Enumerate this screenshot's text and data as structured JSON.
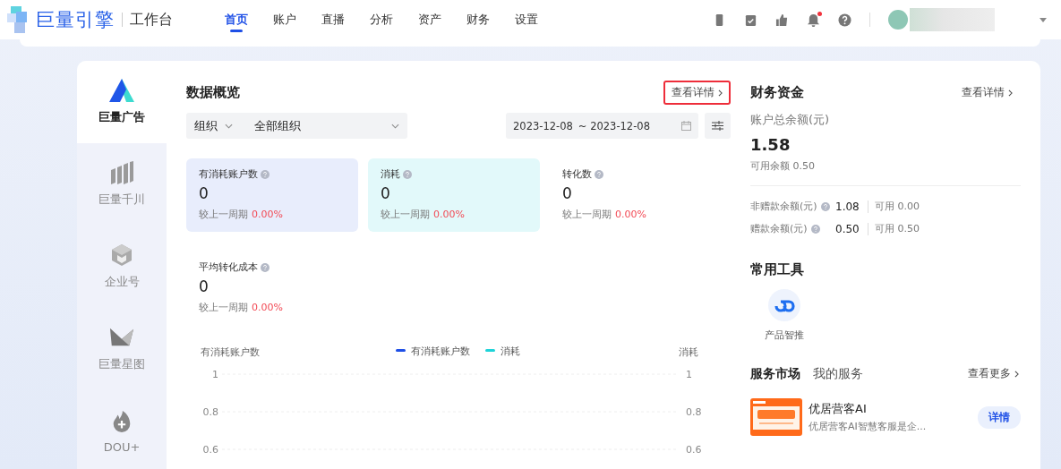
{
  "header": {
    "brand": "巨量引擎",
    "workspace": "工作台",
    "nav": [
      {
        "label": "首页",
        "selected": true
      },
      {
        "label": "账户",
        "selected": false
      },
      {
        "label": "直播",
        "selected": false
      },
      {
        "label": "分析",
        "selected": false
      },
      {
        "label": "资产",
        "selected": false
      },
      {
        "label": "财务",
        "selected": false
      },
      {
        "label": "设置",
        "selected": false
      }
    ],
    "notification_dot": true
  },
  "sidebar": {
    "items": [
      {
        "label": "巨量广告",
        "kind": "ads",
        "selected": true
      },
      {
        "label": "巨量千川",
        "kind": "qianchuan",
        "selected": false
      },
      {
        "label": "企业号",
        "kind": "enterprise",
        "selected": false
      },
      {
        "label": "巨量星图",
        "kind": "xingtu",
        "selected": false
      },
      {
        "label": "DOU+",
        "kind": "dou",
        "selected": false
      }
    ]
  },
  "overview": {
    "title": "数据概览",
    "detail_link": {
      "label": "查看详情",
      "highlighted": true
    },
    "filter": {
      "type": "组织",
      "value": "全部组织"
    },
    "date_start": "2023-12-08",
    "date_end": "~ 2023-12-08",
    "metrics": [
      {
        "label": "有消耗账户数",
        "value": "0",
        "compare_label": "较上一周期",
        "change": "0.00%",
        "color": "#e8edfc"
      },
      {
        "label": "消耗",
        "value": "0",
        "compare_label": "较上一周期",
        "change": "0.00%",
        "color": "#e2f9fa"
      },
      {
        "label": "转化数",
        "value": "0",
        "compare_label": "较上一周期",
        "change": "0.00%"
      },
      {
        "label": "平均转化成本",
        "value": "0",
        "compare_label": "较上一周期",
        "change": "0.00%"
      }
    ],
    "chart_data": {
      "type": "line",
      "ylabel": "有消耗账户数",
      "y2label": "消耗",
      "ylim": [
        0.6,
        1
      ],
      "yticks": [
        1,
        0.8,
        0.6
      ],
      "y2lim": [
        0.6,
        1
      ],
      "y2ticks": [
        1,
        0.8,
        0.6
      ],
      "series": [
        {
          "name": "有消耗账户数",
          "color": "#1e4fe6"
        },
        {
          "name": "消耗",
          "color": "#1ed3d8"
        }
      ]
    }
  },
  "finance": {
    "title": "财务资金",
    "detail_link": "查看详情",
    "total_label": "账户总余额(元)",
    "total": "1.58",
    "available": "可用余额 0.50",
    "rows": [
      {
        "label": "非赠款余额(元)",
        "amount": "1.08",
        "available": "可用 0.00"
      },
      {
        "label": "赠款余额(元)",
        "amount": "0.50",
        "available": "可用 0.50"
      }
    ]
  },
  "tools": {
    "title": "常用工具",
    "items": [
      {
        "label": "产品智推"
      }
    ]
  },
  "market": {
    "tabs": [
      {
        "label": "服务市场",
        "selected": true
      },
      {
        "label": "我的服务",
        "selected": false
      }
    ],
    "more_link": "查看更多",
    "services": [
      {
        "name": "优居营客AI",
        "description": "优居营客AI智慧客服是企...",
        "button": "详情"
      }
    ]
  }
}
